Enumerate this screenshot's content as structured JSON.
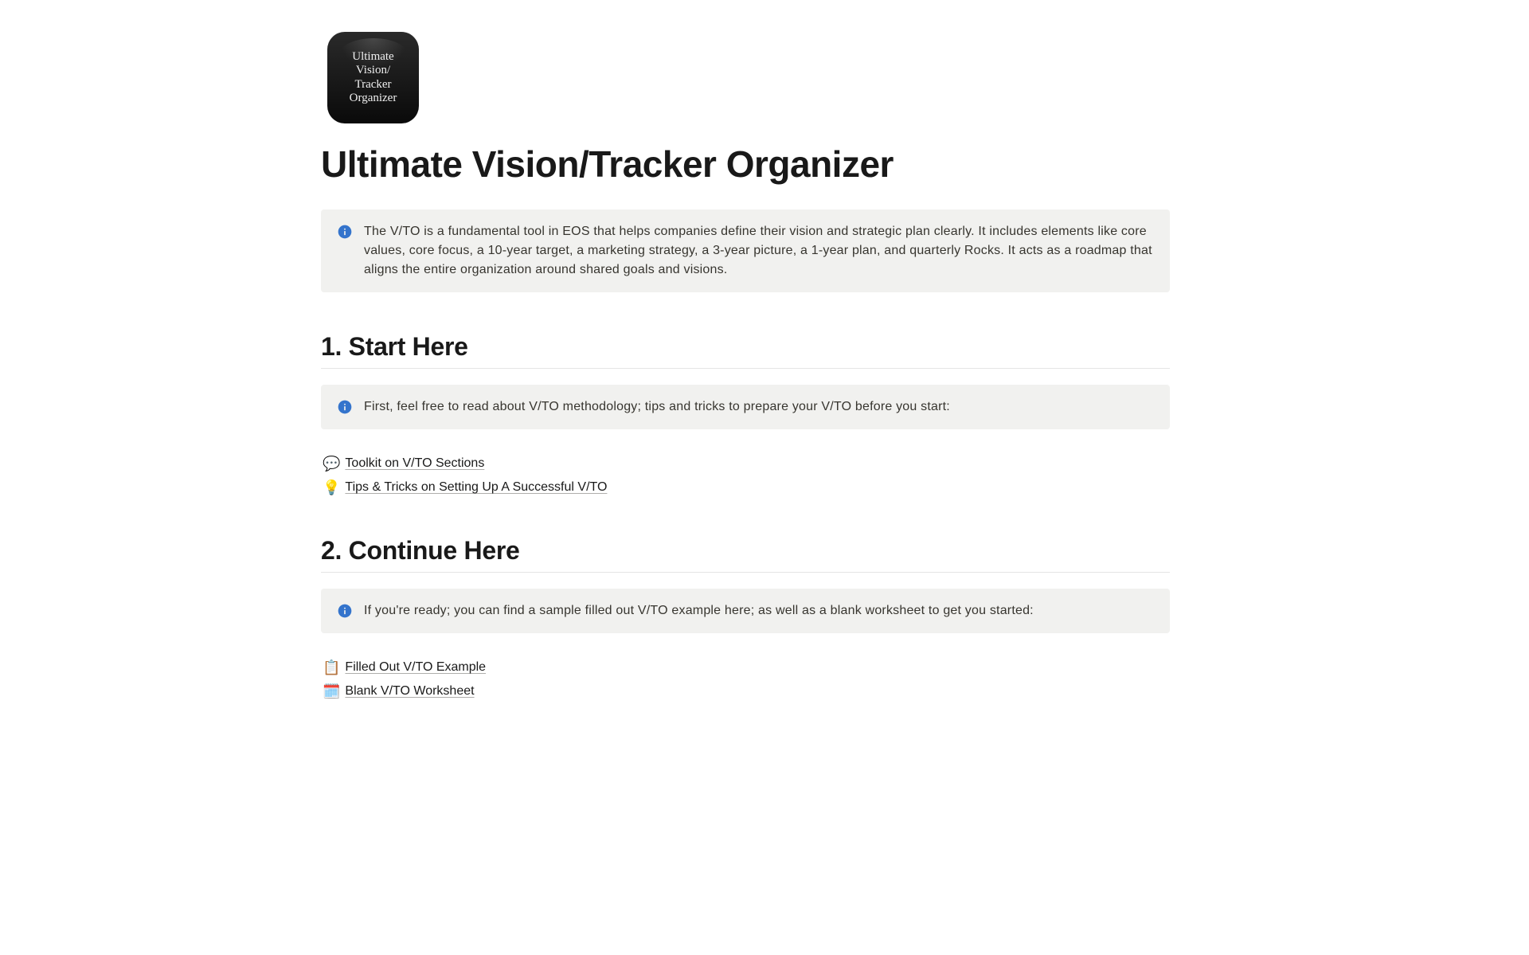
{
  "app_icon_text": "Ultimate\nVision/\nTracker\nOrganizer",
  "page_title": "Ultimate Vision/Tracker Organizer",
  "intro_callout": "The V/TO is a fundamental tool in EOS that helps companies define their vision and strategic plan clearly. It includes elements like core values, core focus, a 10-year target, a marketing strategy, a 3-year picture, a 1-year plan, and quarterly Rocks. It acts as a roadmap that aligns the entire organization around shared goals and visions.",
  "section1": {
    "heading": "1. Start Here",
    "callout": "First, feel free to read about V/TO methodology; tips and tricks to prepare your V/TO before you start:",
    "links": [
      {
        "emoji": "💬",
        "text": "Toolkit on V/TO Sections"
      },
      {
        "emoji": "💡",
        "text": "Tips & Tricks on Setting Up A Successful V/TO"
      }
    ]
  },
  "section2": {
    "heading": "2. Continue Here",
    "callout": "If you're ready; you can find a sample filled out V/TO example here; as well as a blank worksheet to get you started:",
    "links": [
      {
        "emoji": "📋",
        "text": "Filled Out V/TO Example"
      },
      {
        "emoji": "🗓️",
        "text": "Blank V/TO Worksheet"
      }
    ]
  },
  "colors": {
    "info_icon": "#3474cc",
    "callout_bg": "#f1f1ef",
    "text": "#191919"
  }
}
